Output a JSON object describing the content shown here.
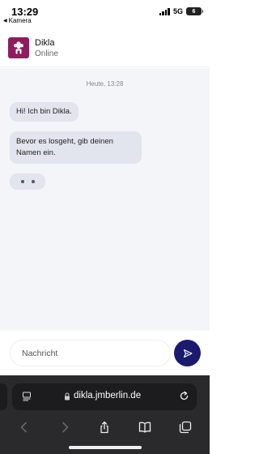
{
  "status_bar": {
    "time": "13:29",
    "back_label": "Kamera",
    "network": "5G",
    "battery": "6"
  },
  "chat_header": {
    "name": "Dikla",
    "status": "Online",
    "avatar_icon": "dikla-logo-icon",
    "avatar_color": "#8e1c5f"
  },
  "chat": {
    "timestamp": "Heute, 13:28",
    "messages": [
      {
        "sender": "bot",
        "text": "Hi! Ich bin Dikla."
      },
      {
        "sender": "bot",
        "text": "Bevor es losgeht, gib deinen Namen ein."
      }
    ],
    "typing_indicator": true
  },
  "composer": {
    "placeholder": "Nachricht",
    "value": "",
    "send_icon": "send-icon",
    "send_color": "#1a1a6e"
  },
  "browser": {
    "url": "dikla.jmberlin.de",
    "toolbar_icons": [
      "back-arrow-icon",
      "forward-arrow-icon",
      "share-icon",
      "bookmarks-icon",
      "tabs-icon"
    ]
  }
}
